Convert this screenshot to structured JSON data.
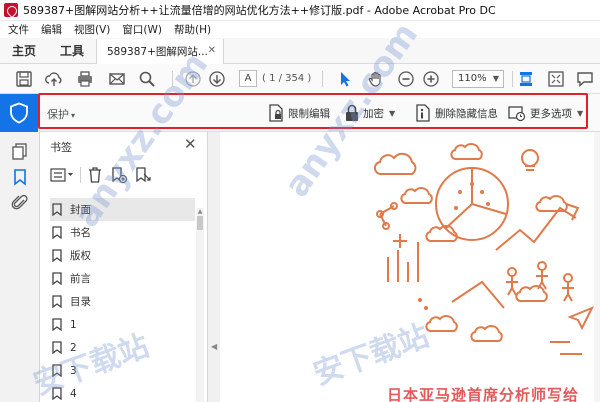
{
  "window": {
    "title": "589387+图解网站分析++让流量倍增的网站优化方法++修订版.pdf - Adobe Acrobat Pro DC"
  },
  "menu": {
    "items": [
      "文件",
      "编辑",
      "视图(V)",
      "窗口(W)",
      "帮助(H)"
    ]
  },
  "tabs": {
    "home": "主页",
    "tools": "工具",
    "document": "589387+图解网站..."
  },
  "toolbar": {
    "page_current": "A",
    "page_count": "( 1 / 354 )",
    "zoom": "110%"
  },
  "protect": {
    "label": "保护",
    "restrict_edit": "限制编辑",
    "encrypt": "加密",
    "remove_hidden": "删除隐藏信息",
    "more_options": "更多选项"
  },
  "bookmarks": {
    "title": "书签",
    "items": [
      "封面",
      "书名",
      "版权",
      "前言",
      "目录",
      "1",
      "2",
      "3",
      "4"
    ]
  },
  "document": {
    "cover_title": "日本亚马逊首席分析师写给"
  },
  "watermark": {
    "text": "anyxz.com",
    "brand": "安下载站"
  },
  "colors": {
    "accent": "#1473e6",
    "highlight_border": "#e3202a",
    "illustration": "#e07a4a"
  }
}
